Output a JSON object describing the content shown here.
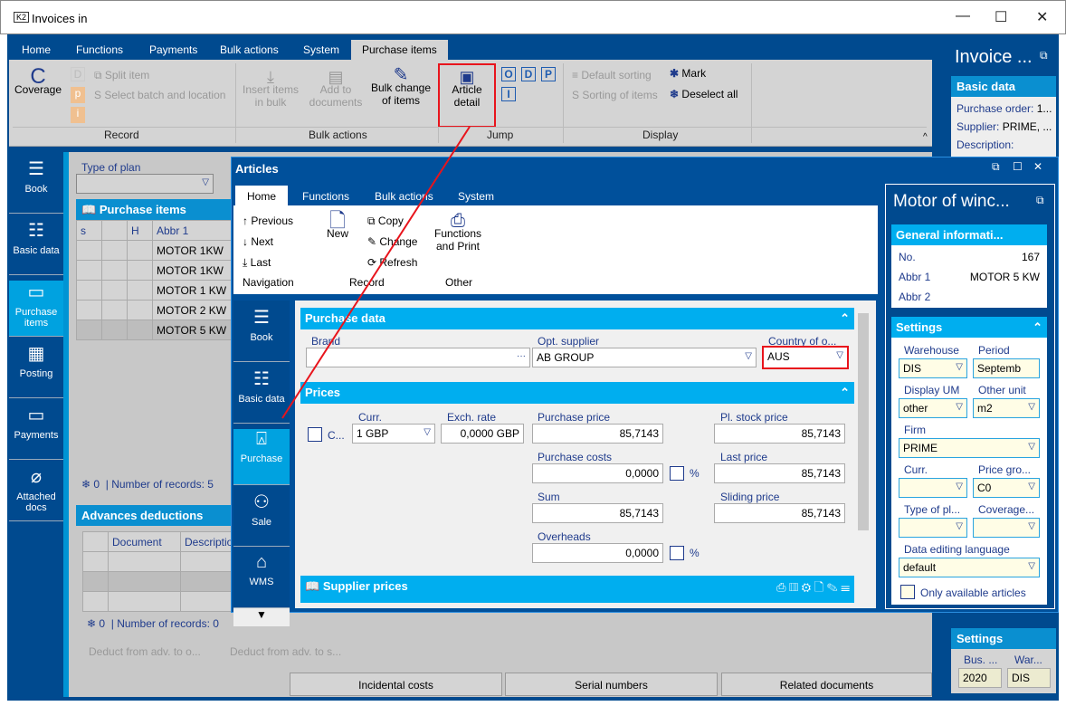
{
  "window": {
    "title": "Invoices in",
    "logo": "K2"
  },
  "ribbon": {
    "tabs": [
      "Home",
      "Functions",
      "Payments",
      "Bulk actions",
      "System",
      "Purchase items"
    ],
    "coverage": "Coverage",
    "split_item": "Split item",
    "select_batch": "Select batch and location",
    "insert_bulk": "Insert items in bulk",
    "add_docs": "Add to documents",
    "bulk_change": "Bulk change of items",
    "article_detail": "Article detail",
    "jump_letters": [
      "O",
      "D",
      "P",
      "I"
    ],
    "default_sorting": "Default sorting",
    "sorting_items": "Sorting of items",
    "mark": "Mark",
    "deselect_all": "Deselect all",
    "groups": [
      "Record",
      "Bulk actions",
      "Jump",
      "Display"
    ]
  },
  "nav": [
    "Book",
    "Basic data",
    "Purchase items",
    "Posting",
    "Payments",
    "Attached docs"
  ],
  "type_of_plan": "Type of plan",
  "purchase_items": {
    "title": "Purchase items",
    "columns": [
      "s",
      "",
      "H",
      "Abbr 1"
    ],
    "rows": [
      "MOTOR  1KW",
      "MOTOR  1KW",
      "MOTOR 1 KW",
      "MOTOR 2 KW",
      "MOTOR 5 KW"
    ],
    "marked": "0",
    "records": "Number of records: 5"
  },
  "advances": {
    "title": "Advances deductions",
    "columns": [
      "",
      "Document",
      "Descriptio"
    ],
    "marked": "0",
    "records": "Number of records: 0",
    "btn1": "Deduct from adv. to o...",
    "btn2": "Deduct from adv. to s..."
  },
  "bottom_buttons": [
    "Incidental costs",
    "Serial numbers",
    "Related documents"
  ],
  "invoice_panel": {
    "title": "Invoice ...",
    "basic_data": "Basic data",
    "purchase_order": "Purchase order:",
    "purchase_order_val": "1...",
    "supplier": "Supplier:",
    "supplier_val": "PRIME, ...",
    "description": "Description:",
    "settings": "Settings",
    "bus": "Bus. ...",
    "war": "War...",
    "bus_val": "2020",
    "war_val": "DIS"
  },
  "articles": {
    "title": "Articles",
    "tabs": [
      "Home",
      "Functions",
      "Bulk actions",
      "System"
    ],
    "previous": "Previous",
    "next": "Next",
    "last": "Last",
    "navigation": "Navigation",
    "new": "New",
    "copy": "Copy",
    "change": "Change",
    "refresh": "Refresh",
    "record": "Record",
    "functions_print": "Functions and Print",
    "other": "Other",
    "nav": [
      "Book",
      "Basic data",
      "Purchase",
      "Sale",
      "WMS"
    ],
    "purchase_data": "Purchase data",
    "brand": "Brand",
    "opt_supplier": "Opt. supplier",
    "opt_supplier_val": "AB GROUP",
    "country": "Country of o...",
    "country_val": "AUS",
    "prices": "Prices",
    "c": "C...",
    "curr": "Curr.",
    "curr_val": "1 GBP",
    "exch": "Exch. rate",
    "exch_val": "0,0000 GBP",
    "purchase_price": "Purchase price",
    "purchase_price_val": "85,7143",
    "purchase_costs": "Purchase costs",
    "purchase_costs_val": "0,0000",
    "sum": "Sum",
    "sum_val": "85,7143",
    "overheads": "Overheads",
    "overheads_val": "0,0000",
    "pct": "%",
    "pl_stock": "Pl. stock price",
    "pl_stock_val": "85,7143",
    "last_price": "Last price",
    "last_price_val": "85,7143",
    "sliding": "Sliding price",
    "sliding_val": "85,7143",
    "supplier_prices": "Supplier prices"
  },
  "article_panel": {
    "title": "Motor of winc...",
    "general": "General informati...",
    "no": "No.",
    "no_val": "167",
    "abbr1": "Abbr 1",
    "abbr1_val": "MOTOR 5 KW",
    "abbr2": "Abbr 2",
    "settings": "Settings",
    "warehouse": "Warehouse",
    "warehouse_val": "DIS",
    "period": "Period",
    "period_val": "Septemb",
    "display_um": "Display UM",
    "display_um_val": "other",
    "other_unit": "Other unit",
    "other_unit_val": "m2",
    "firm": "Firm",
    "firm_val": "PRIME",
    "curr": "Curr.",
    "curr_val": "",
    "price_group": "Price gro...",
    "price_group_val": "C0",
    "type_plan": "Type of pl...",
    "coverage": "Coverage...",
    "lang": "Data editing language",
    "lang_val": "default",
    "only_available": "Only available articles"
  },
  "colors": {
    "dark_blue": "#004a8f",
    "light_blue": "#00aeef",
    "highlight": "#e8141c"
  }
}
